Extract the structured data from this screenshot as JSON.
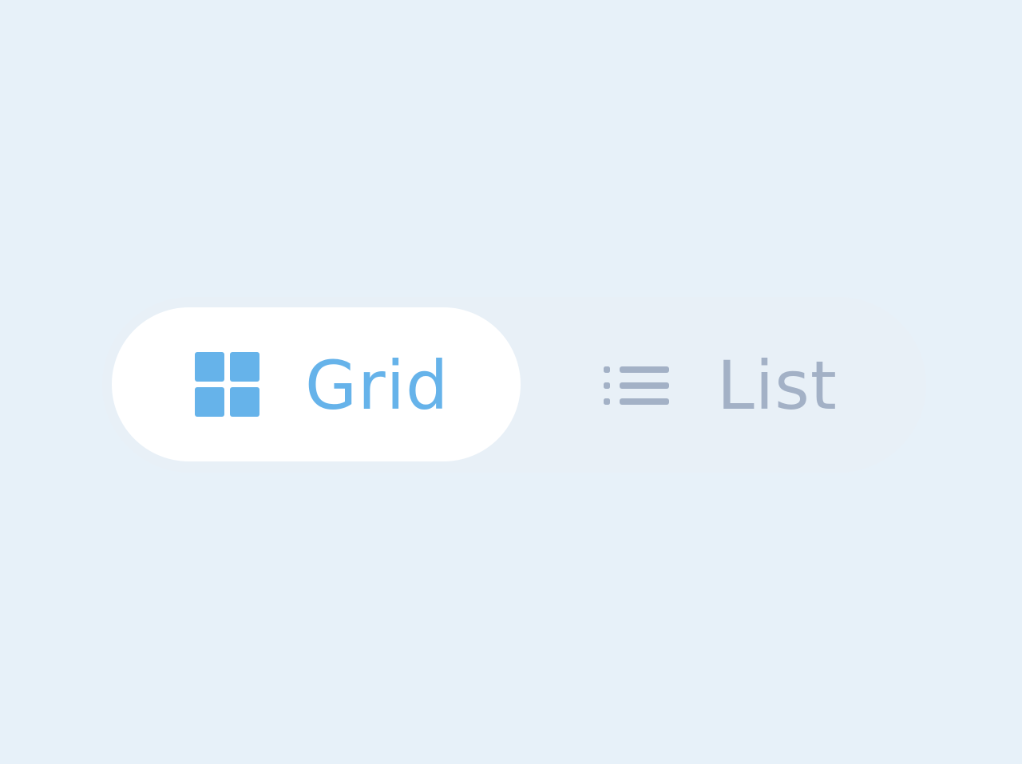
{
  "view_toggle": {
    "options": [
      {
        "key": "grid",
        "label": "Grid",
        "icon": "grid-icon",
        "selected": true
      },
      {
        "key": "list",
        "label": "List",
        "icon": "list-icon",
        "selected": false
      }
    ]
  },
  "colors": {
    "background": "#e7f1f9",
    "track": "#e8f0f7",
    "selected_bg": "#ffffff",
    "selected_fg": "#66b3ea",
    "unselected_fg": "#a3b1c6"
  }
}
